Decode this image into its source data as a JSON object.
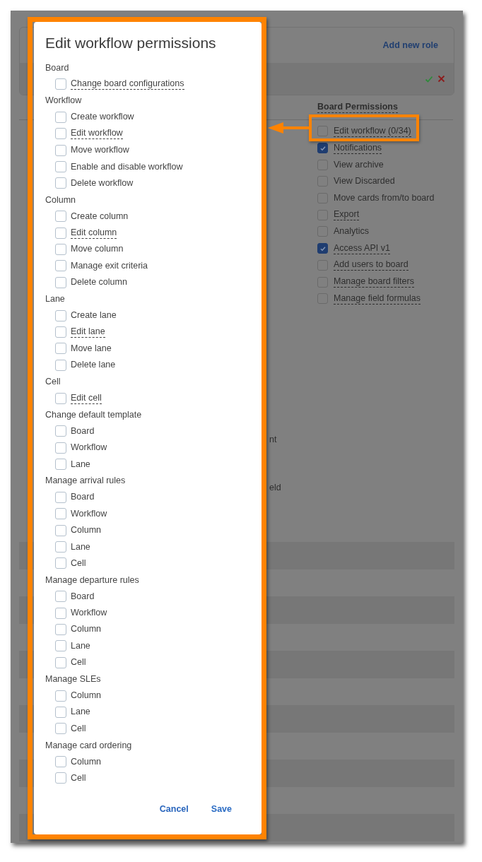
{
  "background": {
    "add_role_link": "Add new role",
    "board_permissions": {
      "title": "Board Permissions",
      "items": [
        {
          "label": "Edit workflow (0/34)",
          "checked": false,
          "tooltip": true
        },
        {
          "label": "Notifications",
          "checked": true,
          "tooltip": true
        },
        {
          "label": "View archive",
          "checked": false,
          "tooltip": false
        },
        {
          "label": "View Discarded",
          "checked": false,
          "tooltip": false
        },
        {
          "label": "Move cards from/to board",
          "checked": false,
          "tooltip": false
        },
        {
          "label": "Export",
          "checked": false,
          "tooltip": true
        },
        {
          "label": "Analytics",
          "checked": false,
          "tooltip": false
        },
        {
          "label": "Access API v1",
          "checked": true,
          "tooltip": true
        },
        {
          "label": "Add users to board",
          "checked": false,
          "tooltip": true
        },
        {
          "label": "Manage board filters",
          "checked": false,
          "tooltip": true
        },
        {
          "label": "Manage field formulas",
          "checked": false,
          "tooltip": true
        }
      ]
    },
    "fragments": [
      "nt",
      "eld"
    ]
  },
  "dialog": {
    "title": "Edit workflow permissions",
    "groups": [
      {
        "title": "Board",
        "items": [
          {
            "label": "Change board configurations",
            "checked": false,
            "tooltip": true
          }
        ]
      },
      {
        "title": "Workflow",
        "items": [
          {
            "label": "Create workflow",
            "checked": false,
            "tooltip": false
          },
          {
            "label": "Edit workflow",
            "checked": false,
            "tooltip": true
          },
          {
            "label": "Move workflow",
            "checked": false,
            "tooltip": false
          },
          {
            "label": "Enable and disable workflow",
            "checked": false,
            "tooltip": false
          },
          {
            "label": "Delete workflow",
            "checked": false,
            "tooltip": false
          }
        ]
      },
      {
        "title": "Column",
        "items": [
          {
            "label": "Create column",
            "checked": false,
            "tooltip": false
          },
          {
            "label": "Edit column",
            "checked": false,
            "tooltip": true
          },
          {
            "label": "Move column",
            "checked": false,
            "tooltip": false
          },
          {
            "label": "Manage exit criteria",
            "checked": false,
            "tooltip": false
          },
          {
            "label": "Delete column",
            "checked": false,
            "tooltip": false
          }
        ]
      },
      {
        "title": "Lane",
        "items": [
          {
            "label": "Create lane",
            "checked": false,
            "tooltip": false
          },
          {
            "label": "Edit lane",
            "checked": false,
            "tooltip": true
          },
          {
            "label": "Move lane",
            "checked": false,
            "tooltip": false
          },
          {
            "label": "Delete lane",
            "checked": false,
            "tooltip": false
          }
        ]
      },
      {
        "title": "Cell",
        "items": [
          {
            "label": "Edit cell",
            "checked": false,
            "tooltip": true
          }
        ]
      },
      {
        "title": "Change default template",
        "items": [
          {
            "label": "Board",
            "checked": false,
            "tooltip": false
          },
          {
            "label": "Workflow",
            "checked": false,
            "tooltip": false
          },
          {
            "label": "Lane",
            "checked": false,
            "tooltip": false
          }
        ]
      },
      {
        "title": "Manage arrival rules",
        "items": [
          {
            "label": "Board",
            "checked": false,
            "tooltip": false
          },
          {
            "label": "Workflow",
            "checked": false,
            "tooltip": false
          },
          {
            "label": "Column",
            "checked": false,
            "tooltip": false
          },
          {
            "label": "Lane",
            "checked": false,
            "tooltip": false
          },
          {
            "label": "Cell",
            "checked": false,
            "tooltip": false
          }
        ]
      },
      {
        "title": "Manage departure rules",
        "items": [
          {
            "label": "Board",
            "checked": false,
            "tooltip": false
          },
          {
            "label": "Workflow",
            "checked": false,
            "tooltip": false
          },
          {
            "label": "Column",
            "checked": false,
            "tooltip": false
          },
          {
            "label": "Lane",
            "checked": false,
            "tooltip": false
          },
          {
            "label": "Cell",
            "checked": false,
            "tooltip": false
          }
        ]
      },
      {
        "title": "Manage SLEs",
        "items": [
          {
            "label": "Column",
            "checked": false,
            "tooltip": false
          },
          {
            "label": "Lane",
            "checked": false,
            "tooltip": false
          },
          {
            "label": "Cell",
            "checked": false,
            "tooltip": false
          }
        ]
      },
      {
        "title": "Manage card ordering",
        "items": [
          {
            "label": "Column",
            "checked": false,
            "tooltip": false
          },
          {
            "label": "Cell",
            "checked": false,
            "tooltip": false
          }
        ]
      }
    ],
    "buttons": [
      {
        "label": "Cancel",
        "kind": "cancel"
      },
      {
        "label": "Save",
        "kind": "save"
      }
    ]
  }
}
